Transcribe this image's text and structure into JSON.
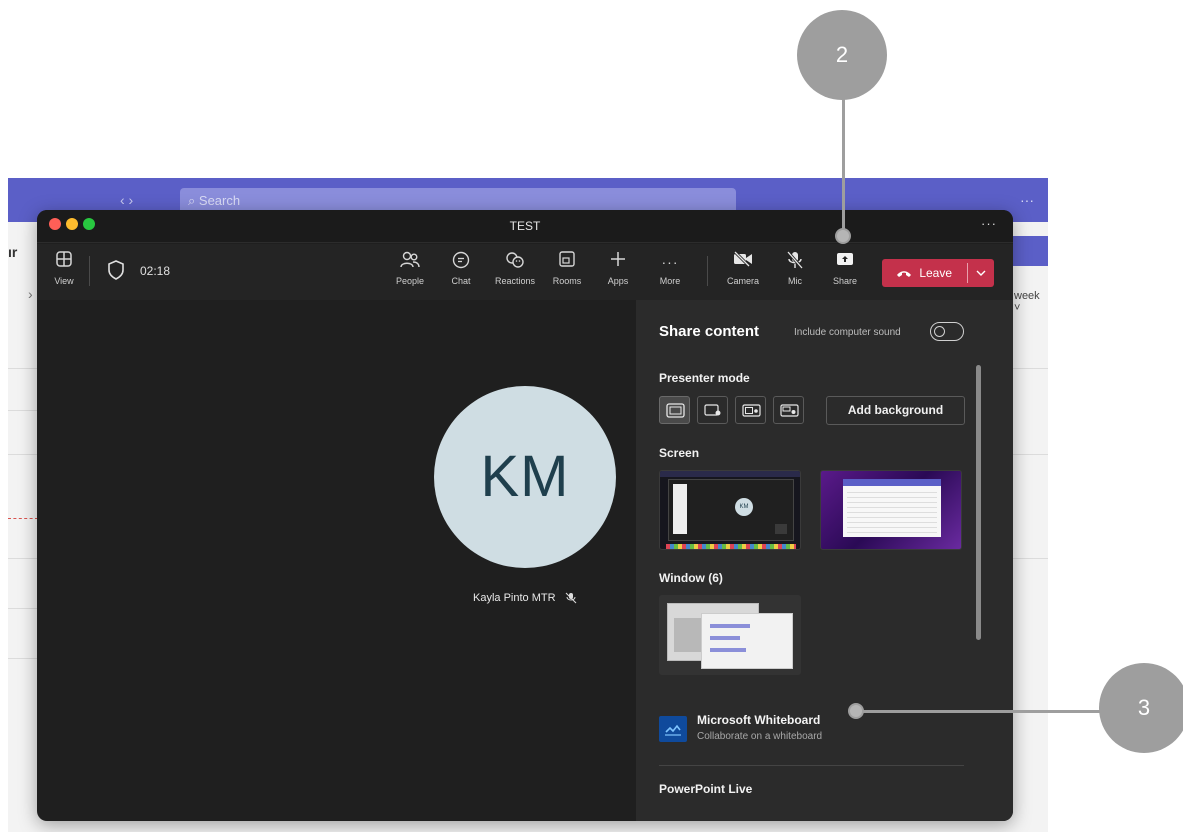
{
  "background_app": {
    "search_placeholder": "Search",
    "nav_arrows": "‹  ›",
    "more": "···",
    "left_edge_text": "ır",
    "left_chevron": "›",
    "right_week_label": "week ˅"
  },
  "window": {
    "title": "TEST",
    "more": "···",
    "traffic_colors": [
      "#ff5f57",
      "#febc2e",
      "#28c840"
    ]
  },
  "toolbar": {
    "view_label": "View",
    "timer": "02:18",
    "people_label": "People",
    "chat_label": "Chat",
    "reactions_label": "Reactions",
    "rooms_label": "Rooms",
    "apps_label": "Apps",
    "more_label": "More",
    "camera_label": "Camera",
    "mic_label": "Mic",
    "share_label": "Share",
    "leave_label": "Leave",
    "leave_color": "#c4314b"
  },
  "stage": {
    "initials": "KM",
    "participant_name": "Kayla Pinto MTR"
  },
  "share_panel": {
    "title": "Share content",
    "include_sound_label": "Include computer sound",
    "include_sound_on": false,
    "presenter_mode_label": "Presenter mode",
    "add_background_label": "Add background",
    "screen_label": "Screen",
    "window_label": "Window (6)",
    "whiteboard_title": "Microsoft Whiteboard",
    "whiteboard_subtitle": "Collaborate on a whiteboard",
    "powerpoint_label": "PowerPoint Live",
    "thumb_avatar_initials": "KM"
  },
  "callouts": {
    "two": "2",
    "three": "3"
  }
}
